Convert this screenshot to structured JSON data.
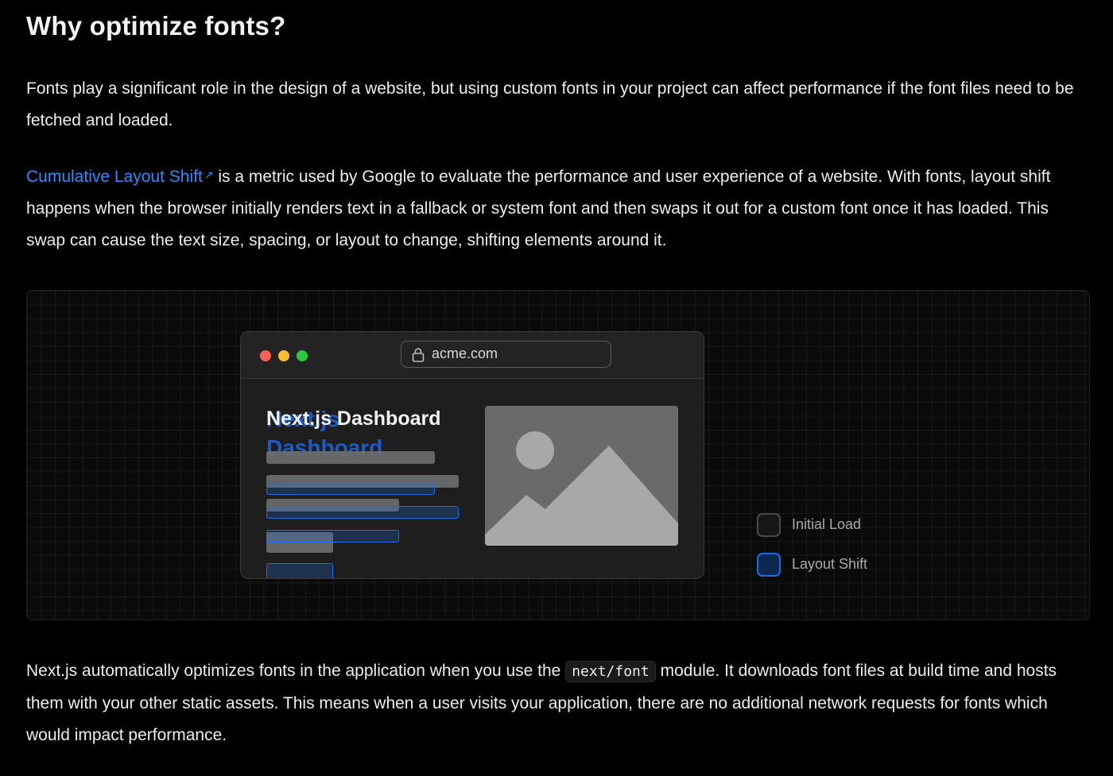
{
  "heading": "Why optimize fonts?",
  "paragraph1": "Fonts play a significant role in the design of a website, but using custom fonts in your project can affect performance if the font files need to be fetched and loaded.",
  "paragraph2": {
    "link_text": "Cumulative Layout Shift",
    "link_icon": "external-arrow-icon",
    "rest": " is a metric used by Google to evaluate the performance and user experience of a website. With fonts, layout shift happens when the browser initially renders text in a fallback or system font and then swaps it out for a custom font once it has loaded. This swap can cause the text size, spacing, or layout to change, shifting elements around it."
  },
  "illustration": {
    "browser": {
      "url": "acme.com",
      "lock_icon": "lock-icon",
      "window_controls": [
        "#ff5f57",
        "#febc2e",
        "#28c840"
      ],
      "title_fallback": "Next.js Dashboard",
      "title_custom": "Next.js Dashboard",
      "image_icon": "image-placeholder-icon"
    },
    "legend": {
      "initial_label": "Initial Load",
      "shift_label": "Layout Shift"
    },
    "colors": {
      "shift": "#1f6be0",
      "initial": "#6e6e6e"
    }
  },
  "paragraph3": {
    "before": "Next.js automatically optimizes fonts in the application when you use the ",
    "code": "next/font",
    "after": " module. It downloads font files at build time and hosts them with your other static assets. This means when a user visits your application, there are no additional network requests for fonts which would impact performance."
  },
  "colors": {
    "background": "#000000",
    "text": "#ededed",
    "link": "#2f8cff"
  }
}
